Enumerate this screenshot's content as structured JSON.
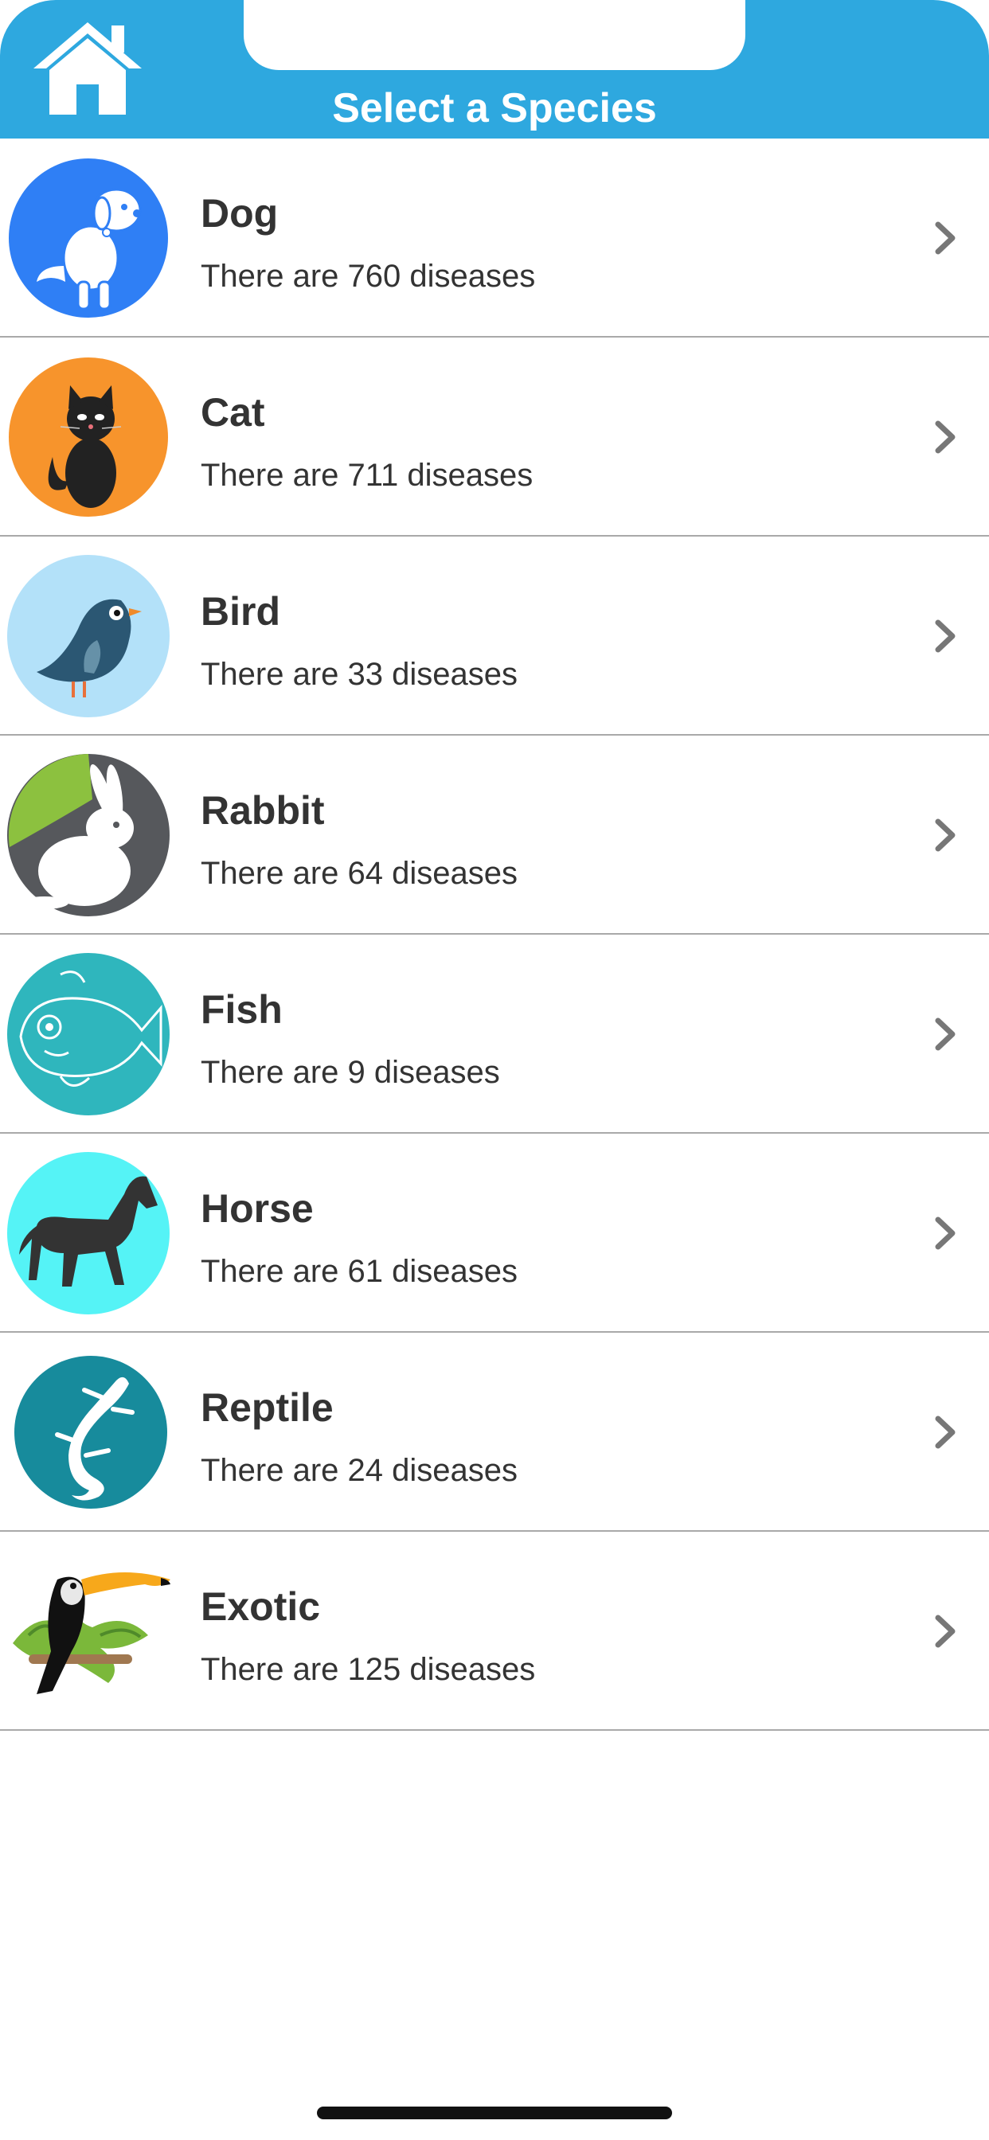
{
  "header": {
    "title": "Select a Species",
    "home_icon": "home-icon",
    "background_color": "#2ea8df"
  },
  "species": [
    {
      "name": "Dog",
      "count_text": "There are 760 diseases",
      "icon": "dog-icon",
      "color": "#2f7ff5"
    },
    {
      "name": "Cat",
      "count_text": "There are 711 diseases",
      "icon": "cat-icon",
      "color": "#f7942c"
    },
    {
      "name": "Bird",
      "count_text": "There are 33 diseases",
      "icon": "bird-icon",
      "color": "#b3e1f9"
    },
    {
      "name": "Rabbit",
      "count_text": "There are 64 diseases",
      "icon": "rabbit-icon",
      "color": "#56585c"
    },
    {
      "name": "Fish",
      "count_text": "There are 9 diseases",
      "icon": "fish-icon",
      "color": "#2fb6bd"
    },
    {
      "name": "Horse",
      "count_text": "There are 61 diseases",
      "icon": "horse-icon",
      "color": "#55f3f6"
    },
    {
      "name": "Reptile",
      "count_text": "There are 24 diseases",
      "icon": "reptile-icon",
      "color": "#178b9c"
    },
    {
      "name": "Exotic",
      "count_text": "There are 125 diseases",
      "icon": "toucan-icon",
      "color": "#f7a81b"
    }
  ],
  "row_chevron_icon": "chevron-right-icon"
}
